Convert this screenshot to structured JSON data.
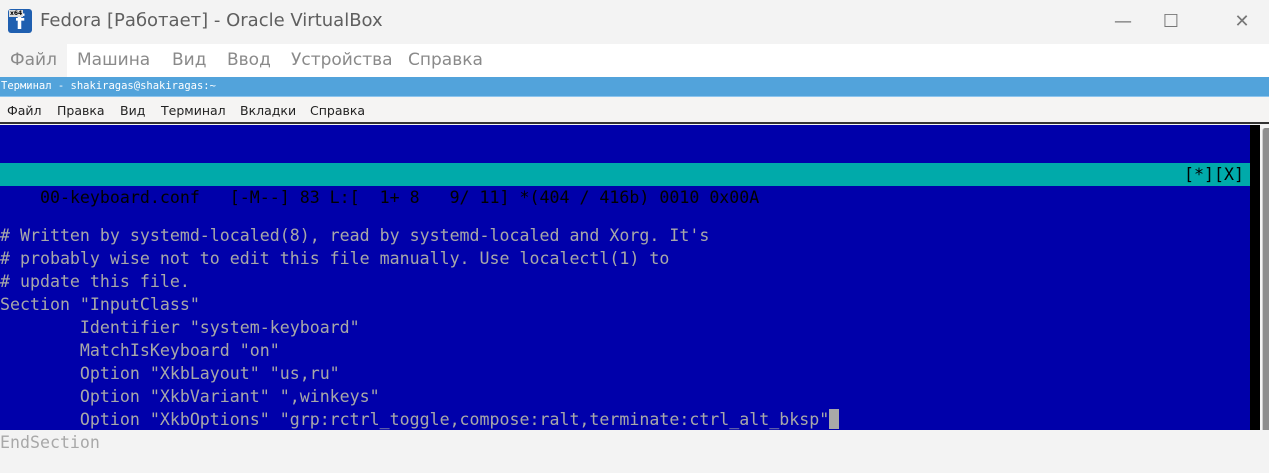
{
  "window": {
    "title": "Fedora [Работает] - Oracle VirtualBox",
    "icon": "virtualbox-fedora-icon",
    "icon_badge": "x64",
    "controls": {
      "minimize": "—",
      "maximize": "☐",
      "close": "✕"
    }
  },
  "vbox_menu": [
    "Файл",
    "Машина",
    "Вид",
    "Ввод",
    "Устройства",
    "Справка"
  ],
  "terminal": {
    "title": "Терминал - shakiragas@shakiragas:~",
    "menu": [
      "Файл",
      "Правка",
      "Вид",
      "Терминал",
      "Вкладки",
      "Справка"
    ]
  },
  "editor": {
    "status_left": "00-keyboard.conf   [-M--] 83 L:[  1+ 8   9/ 11] *(404 / 416b) 0010 0x00A",
    "status_right": "[*][X]",
    "lines": [
      "# Written by systemd-localed(8), read by systemd-localed and Xorg. It's",
      "# probably wise not to edit this file manually. Use localectl(1) to",
      "# update this file.",
      "Section \"InputClass\"",
      "        Identifier \"system-keyboard\"",
      "        MatchIsKeyboard \"on\"",
      "        Option \"XkbLayout\" \"us,ru\"",
      "        Option \"XkbVariant\" \",winkeys\"",
      "        Option \"XkbOptions\" \"grp:rctrl_toggle,compose:ralt,terminate:ctrl_alt_bksp\"",
      "EndSection"
    ],
    "cursor_line": 9,
    "colors": {
      "background": "#0000aa",
      "text": "#a8a8a8",
      "status_bg": "#00aaaa"
    }
  }
}
